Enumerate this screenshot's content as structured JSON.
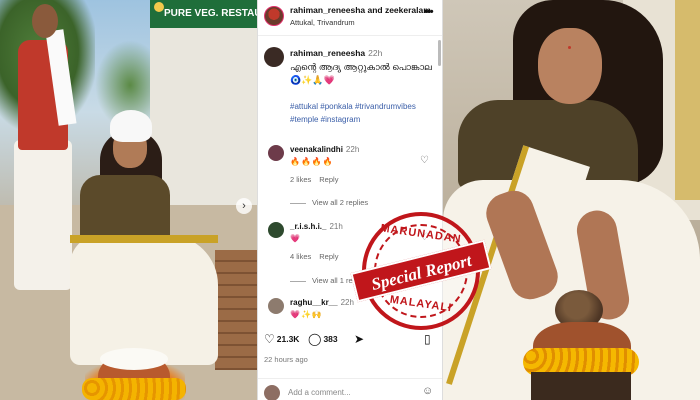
{
  "left_photo": {
    "shop_sign": "PURE VEG. RESTAURAN"
  },
  "post": {
    "header": {
      "users": "rahiman_reneesha and zeekeralam",
      "location": "Attukal, Trivandrum",
      "more_icon": "more-horizontal-icon"
    },
    "caption": {
      "username": "rahiman_reneesha",
      "time": "22h",
      "text": "എന്റെ ആദ്യ ആറ്റുകാൽ പൊങ്കാല🧿✨🙏💗",
      "hashtags": "#attukal #ponkala #trivandrumvibes #temple #instagram"
    },
    "comments": [
      {
        "username": "veenakalindhi",
        "time": "22h",
        "text": "🔥🔥🔥🔥",
        "likes": "2 likes",
        "reply": "Reply",
        "view_replies": "View all 2 replies"
      },
      {
        "username": "_r.i.s.h.i._",
        "time": "21h",
        "text": "💗",
        "likes": "4 likes",
        "reply": "Reply",
        "view_replies": "View all 1 replies"
      },
      {
        "username": "raghu__kr__",
        "time": "22h",
        "text": "💗✨🙌"
      }
    ],
    "actions": {
      "likes_count": "21.3K",
      "comments_count": "383"
    },
    "time_ago": "22 hours ago",
    "add_comment_placeholder": "Add a comment..."
  },
  "stamp": {
    "top": "MARUNADAN",
    "banner": "Special Report",
    "bottom": "MALAYALI",
    "color": "#c0161b"
  }
}
